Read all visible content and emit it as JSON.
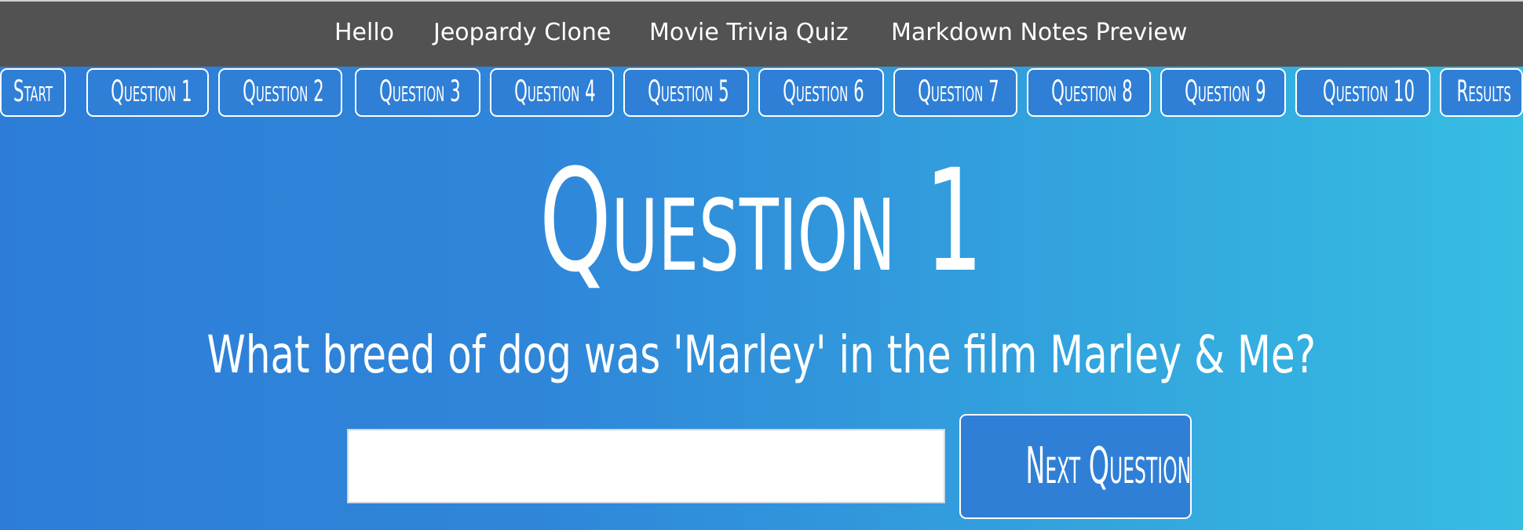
{
  "nav": {
    "links": [
      "Hello",
      "Jeopardy Clone",
      "Movie Trivia Quiz",
      "Markdown Notes Preview"
    ]
  },
  "tabs": [
    "Start",
    "Question 1",
    "Question 2",
    "Question 3",
    "Question 4",
    "Question 5",
    "Question 6",
    "Question 7",
    "Question 8",
    "Question 9",
    "Question 10",
    "Results"
  ],
  "quiz": {
    "title": "Question 1",
    "question": "What breed of dog was 'Marley' in the film Marley & Me?",
    "answer_value": "",
    "next_label": "Next Question"
  },
  "colors": {
    "nav_bg": "#525252",
    "gradient_start": "#2d7dd8",
    "gradient_end": "#36bde2",
    "button_bg": "#2f7fd7"
  }
}
